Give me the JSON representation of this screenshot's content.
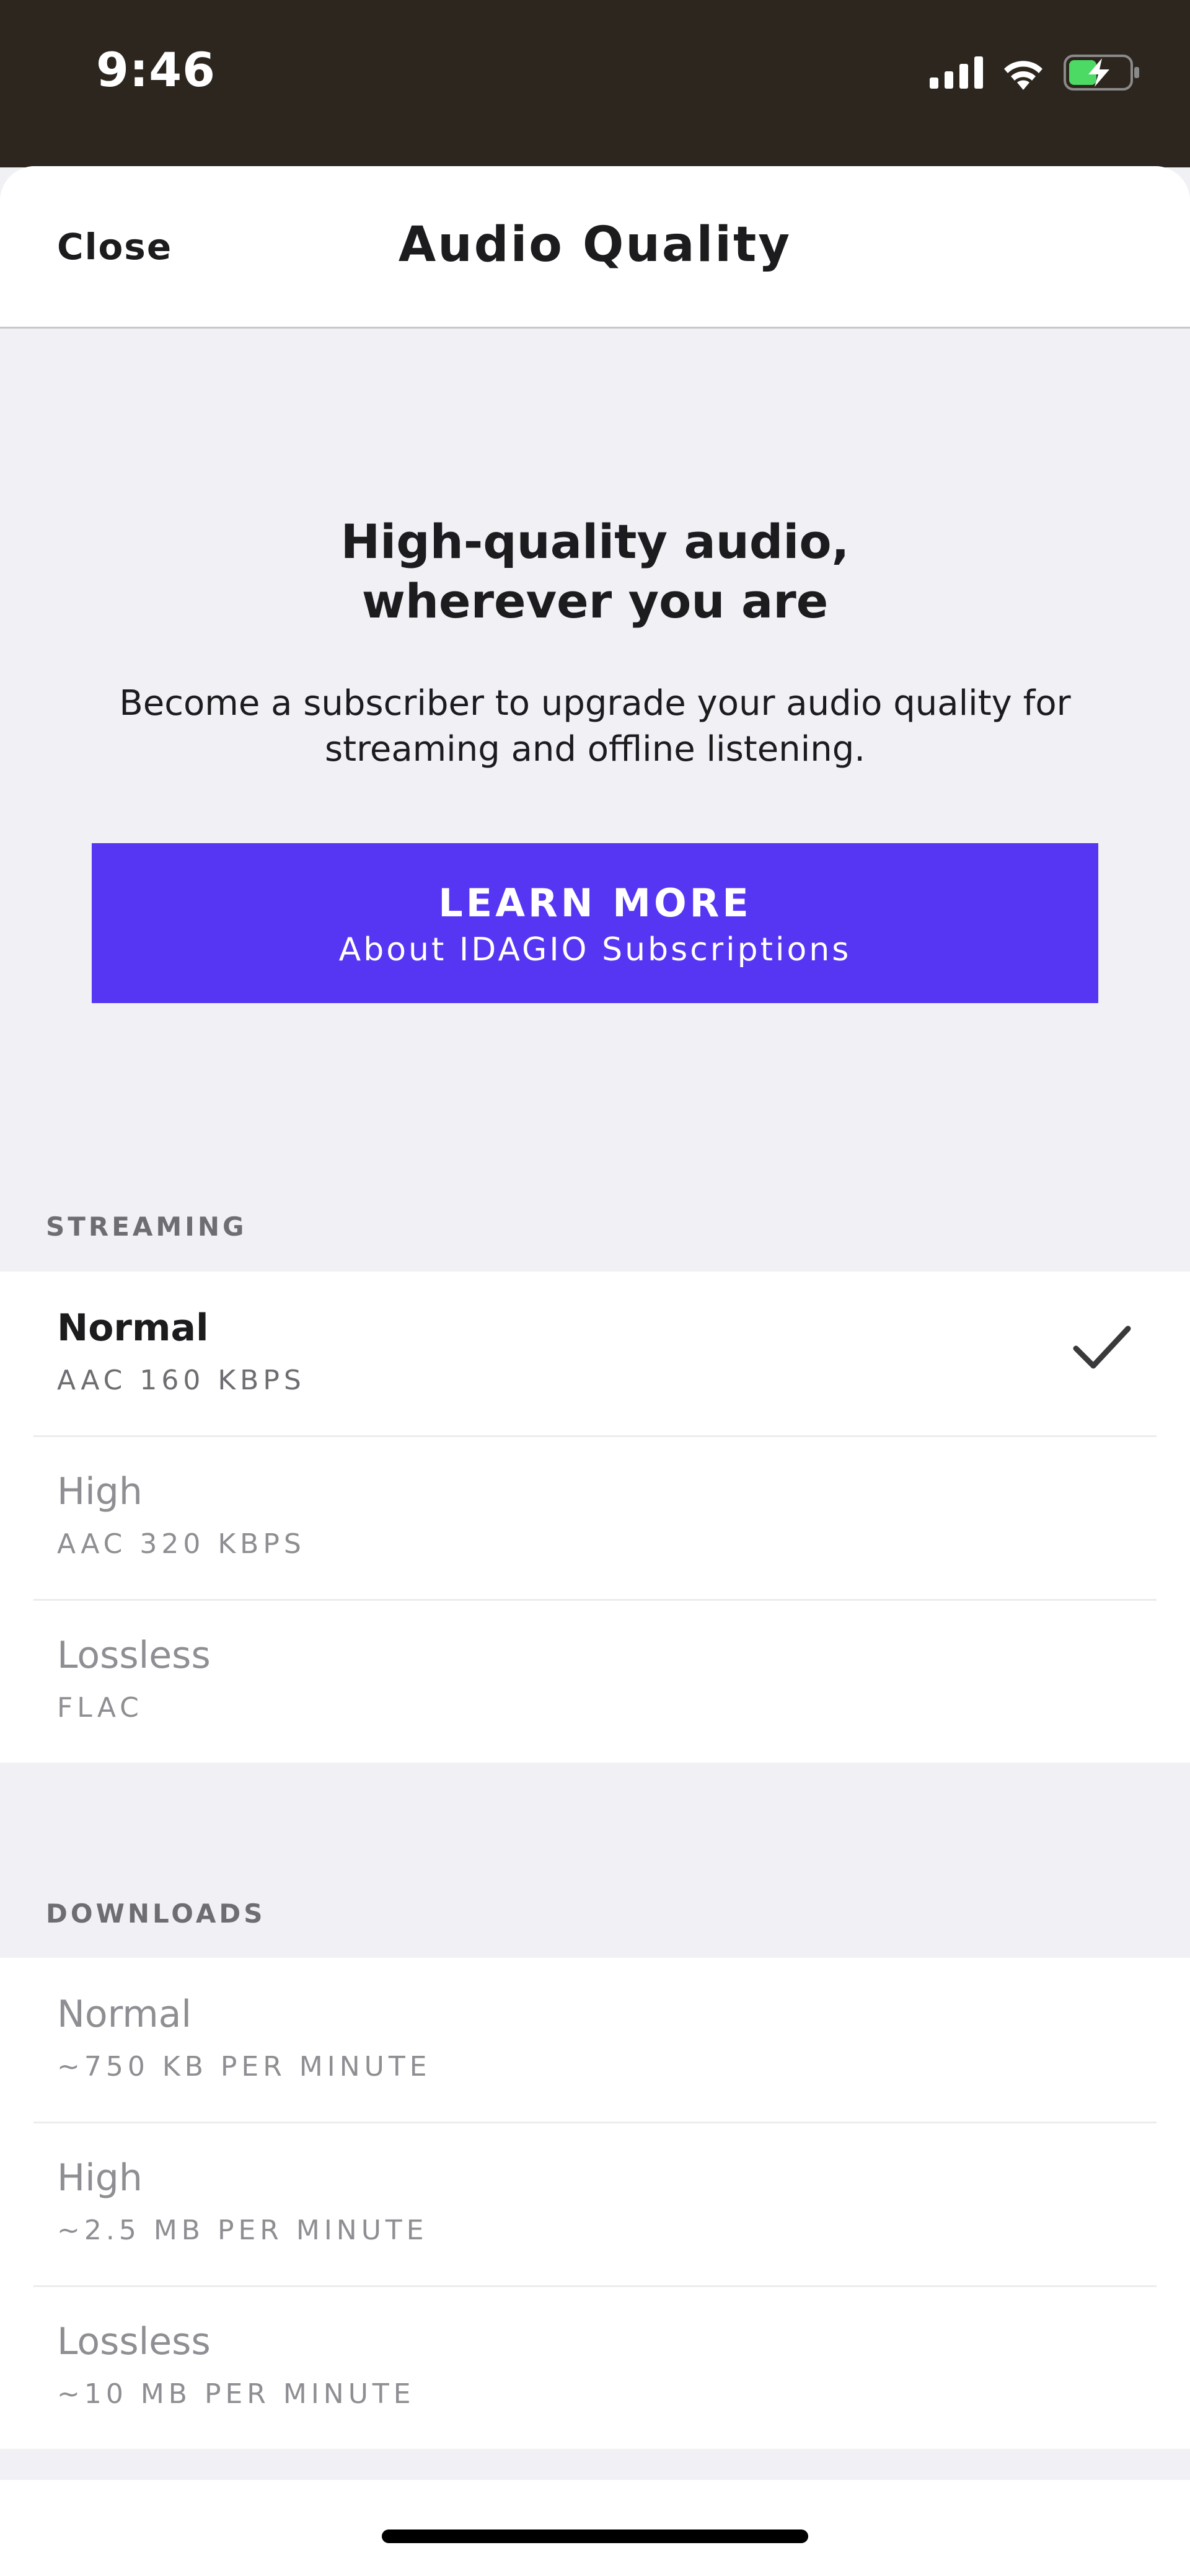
{
  "status_bar": {
    "time": "9:46",
    "icons": [
      "signal-icon",
      "wifi-icon",
      "battery-charging-icon"
    ],
    "battery_color": "#4cd964"
  },
  "nav": {
    "close_label": "Close",
    "title": "Audio Quality"
  },
  "promo": {
    "heading_line1": "High-quality audio,",
    "heading_line2": "wherever you are",
    "text_line1": "Become a subscriber to upgrade your audio quality for",
    "text_line2": "streaming and offline listening.",
    "button_title": "LEARN MORE",
    "button_subtitle": "About IDAGIO Subscriptions",
    "button_color": "#5636f3"
  },
  "streaming": {
    "header": "STREAMING",
    "options": [
      {
        "label": "Normal",
        "detail": "AAC 160 KBPS",
        "selected": true
      },
      {
        "label": "High",
        "detail": "AAC 320 KBPS",
        "selected": false
      },
      {
        "label": "Lossless",
        "detail": "FLAC",
        "selected": false
      }
    ]
  },
  "downloads": {
    "header": "DOWNLOADS",
    "options": [
      {
        "label": "Normal",
        "detail": "~750 KB PER MINUTE",
        "selected": false
      },
      {
        "label": "High",
        "detail": "~2.5 MB PER MINUTE",
        "selected": false
      },
      {
        "label": "Lossless",
        "detail": "~10 MB PER MINUTE",
        "selected": false
      }
    ]
  },
  "colors": {
    "background": "#f1f0f5",
    "status_bar": "#2c261f",
    "disabled_text": "#8e8e93"
  }
}
